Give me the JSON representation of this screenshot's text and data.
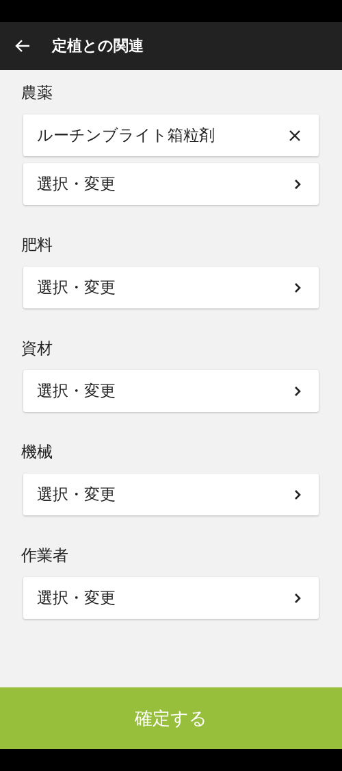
{
  "header": {
    "title": "定植との関連"
  },
  "sections": [
    {
      "label": "農薬",
      "items": [
        {
          "kind": "selected",
          "text": "ルーチンブライト箱粒剤"
        },
        {
          "kind": "picker",
          "text": "選択・変更"
        }
      ]
    },
    {
      "label": "肥料",
      "items": [
        {
          "kind": "picker",
          "text": "選択・変更"
        }
      ]
    },
    {
      "label": "資材",
      "items": [
        {
          "kind": "picker",
          "text": "選択・変更"
        }
      ]
    },
    {
      "label": "機械",
      "items": [
        {
          "kind": "picker",
          "text": "選択・変更"
        }
      ]
    },
    {
      "label": "作業者",
      "items": [
        {
          "kind": "picker",
          "text": "選択・変更"
        }
      ]
    }
  ],
  "confirm_button": "確定する"
}
